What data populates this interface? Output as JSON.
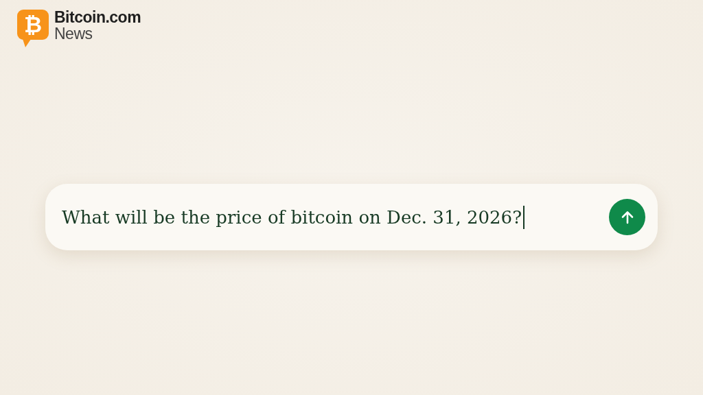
{
  "logo": {
    "mark": "₿",
    "name": "Bitcoin.com",
    "subtitle": "News"
  },
  "prompt": {
    "value": "What will be the price of bitcoin on Dec. 31, 2026?",
    "focused": true
  }
}
